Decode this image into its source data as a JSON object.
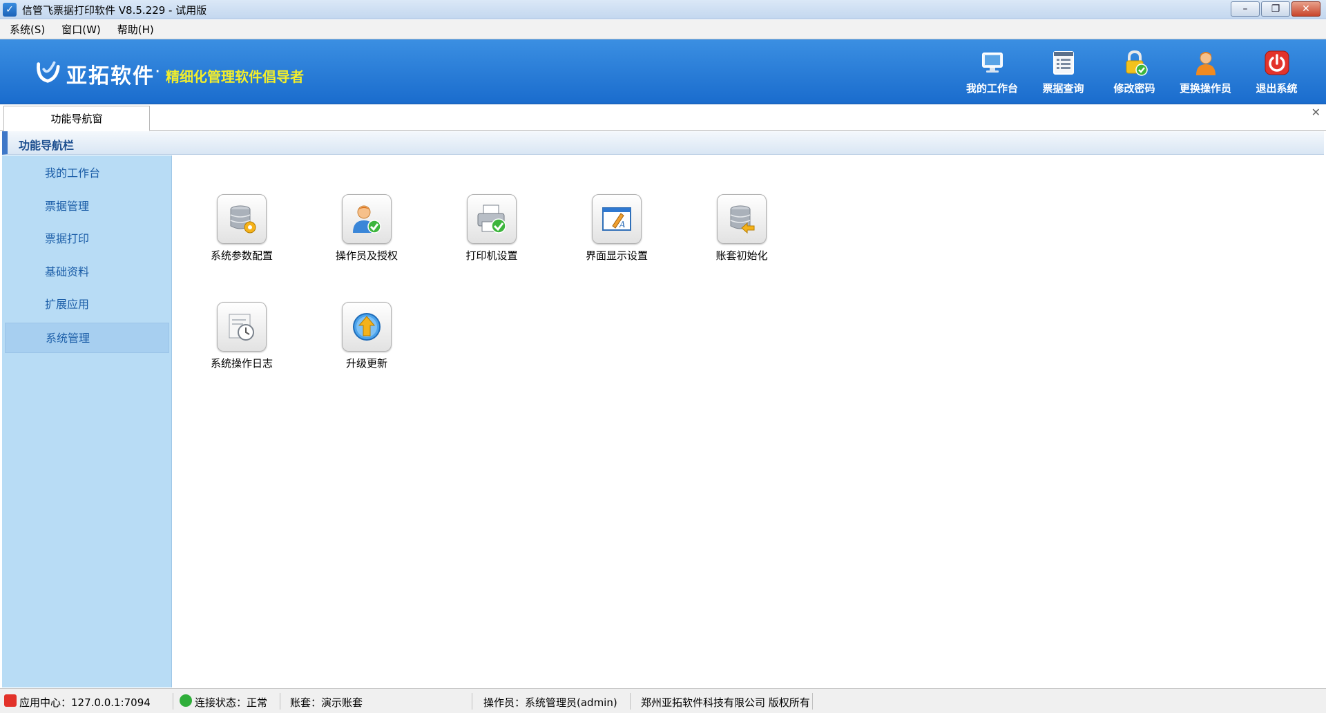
{
  "window": {
    "title": "信管飞票据打印软件 V8.5.229 - 试用版",
    "minimize_glyph": "–",
    "restore_glyph": "❐",
    "close_glyph": "✕"
  },
  "menu": [
    "系统(S)",
    "窗口(W)",
    "帮助(H)"
  ],
  "banner": {
    "logo_name": "亚拓软件",
    "logo_dot": "·",
    "slogan": "精细化管理软件倡导者",
    "toolbar": [
      {
        "label": "我的工作台",
        "icon": "monitor-icon"
      },
      {
        "label": "票据查询",
        "icon": "list-document-icon"
      },
      {
        "label": "修改密码",
        "icon": "lock-icon"
      },
      {
        "label": "更换操作员",
        "icon": "user-icon"
      },
      {
        "label": "退出系统",
        "icon": "power-icon"
      }
    ]
  },
  "tab": {
    "label": "功能导航窗",
    "close_glyph": "✕"
  },
  "nav_header": "功能导航栏",
  "sidebar": {
    "items": [
      "我的工作台",
      "票据管理",
      "票据打印",
      "基础资料",
      "扩展应用",
      "系统管理"
    ],
    "active_index": 5
  },
  "functions": [
    {
      "label": "系统参数配置",
      "icon": "database-gear-icon"
    },
    {
      "label": "操作员及授权",
      "icon": "user-check-icon"
    },
    {
      "label": "打印机设置",
      "icon": "printer-check-icon"
    },
    {
      "label": "界面显示设置",
      "icon": "window-pen-icon"
    },
    {
      "label": "账套初始化",
      "icon": "database-arrow-icon"
    },
    {
      "label": "系统操作日志",
      "icon": "clock-log-icon"
    },
    {
      "label": "升级更新",
      "icon": "upgrade-arrow-icon"
    }
  ],
  "statusbar": {
    "app_center": "应用中心：127.0.0.1:7094",
    "connection": "连接状态：正常",
    "account": "账套：演示账套",
    "operator": "操作员：系统管理员(admin)",
    "copyright": "郑州亚拓软件科技有限公司 版权所有"
  },
  "colors": {
    "banner": "#2a7fd8",
    "slogan": "#f3ee2b",
    "sidebar": "#b8dcf5",
    "sidebar_text": "#1c5ea8"
  }
}
